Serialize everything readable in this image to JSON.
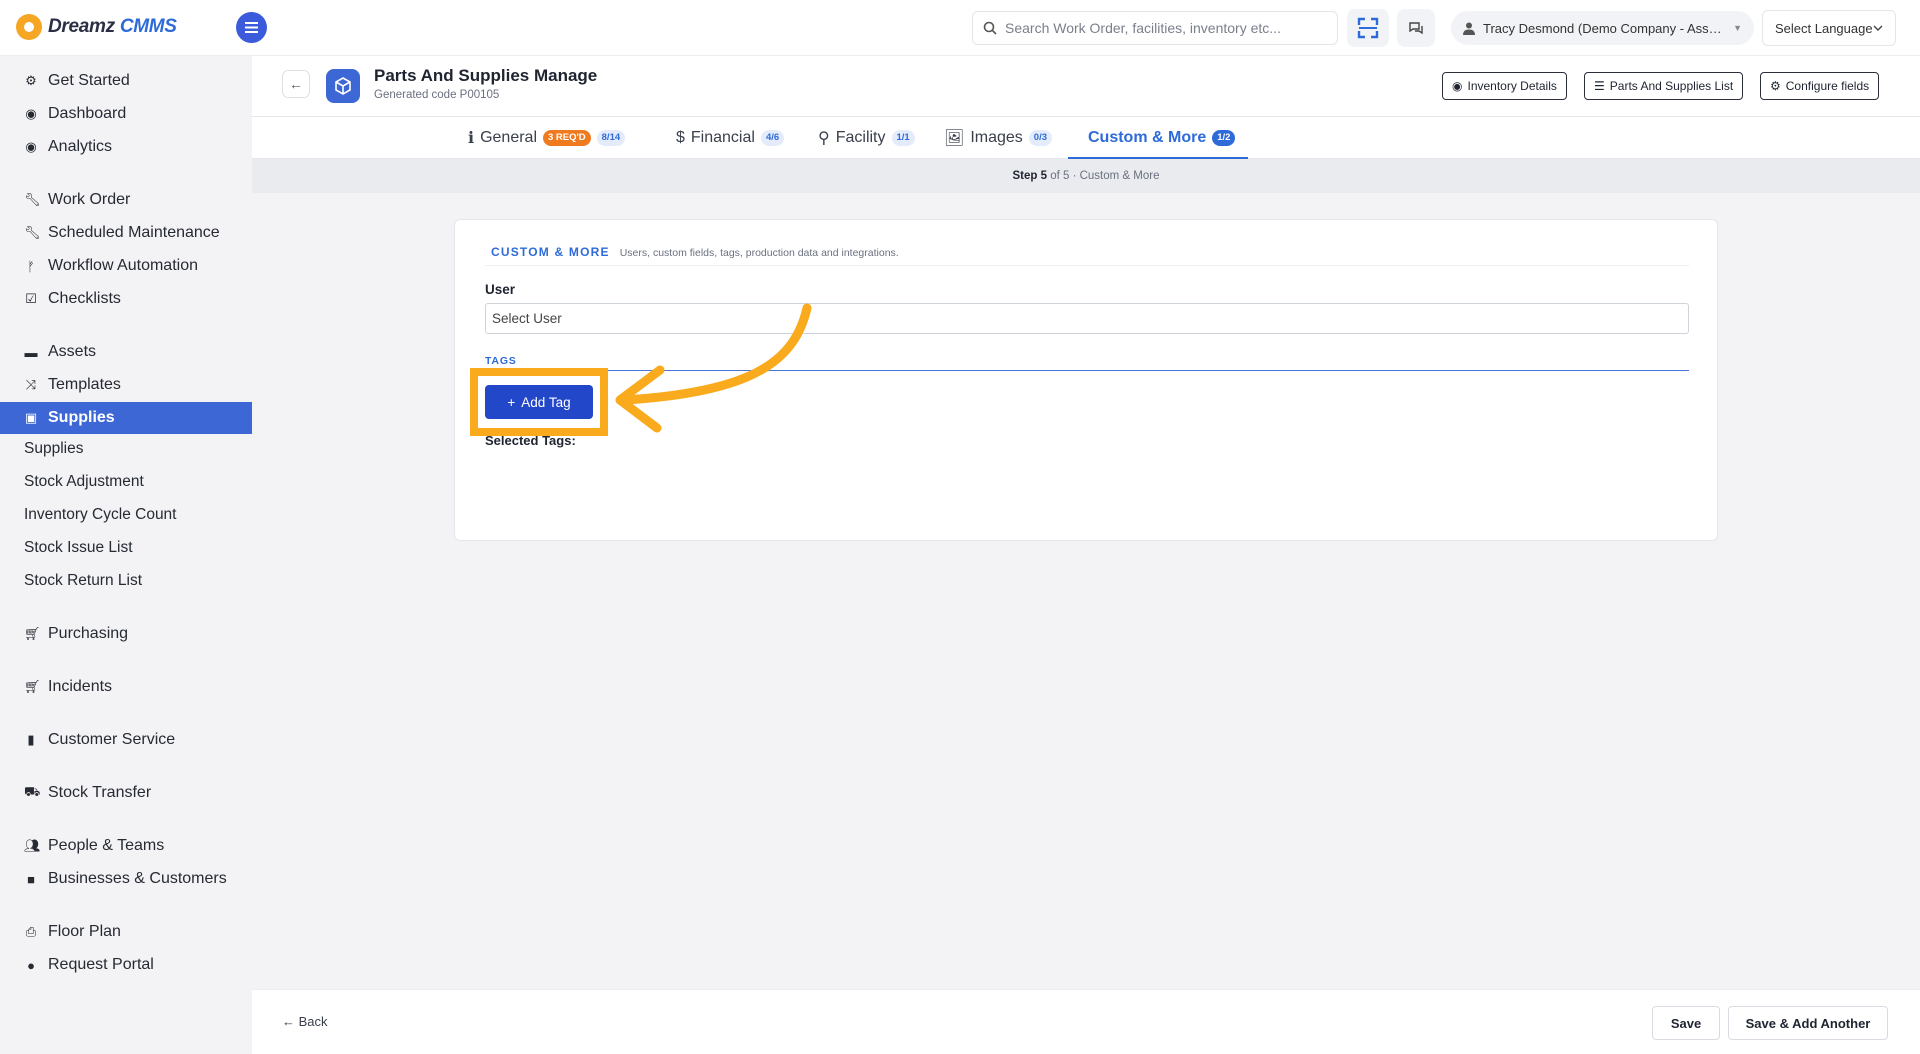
{
  "header": {
    "logo_main": "Dreamz",
    "logo_accent": "CMMS",
    "search_placeholder": "Search Work Order, facilities, inventory etc...",
    "user_label": "Tracy Desmond (Demo Company - Asse...",
    "language_label": "Select Language"
  },
  "sidebar": {
    "items": [
      {
        "label": "Get Started",
        "icon": "cogs-icon"
      },
      {
        "label": "Dashboard",
        "icon": "dashboard-icon"
      },
      {
        "label": "Analytics",
        "icon": "analytics-icon"
      },
      {
        "label": "Work Order",
        "icon": "wrench-icon"
      },
      {
        "label": "Scheduled Maintenance",
        "icon": "wrench-icon"
      },
      {
        "label": "Workflow Automation",
        "icon": "branch-icon"
      },
      {
        "label": "Checklists",
        "icon": "checkbox-icon"
      },
      {
        "label": "Assets",
        "icon": "archive-icon"
      },
      {
        "label": "Templates",
        "icon": "shuffle-icon"
      },
      {
        "label": "Supplies",
        "icon": "suitcase-icon"
      }
    ],
    "sub_items": [
      "Supplies",
      "Stock Adjustment",
      "Inventory Cycle Count",
      "Stock Issue List",
      "Stock Return List"
    ],
    "items_bottom": [
      {
        "label": "Purchasing",
        "icon": "cart-icon"
      },
      {
        "label": "Incidents",
        "icon": "cart-icon"
      },
      {
        "label": "Customer Service",
        "icon": "file-icon"
      },
      {
        "label": "Stock Transfer",
        "icon": "truck-icon"
      },
      {
        "label": "People & Teams",
        "icon": "users-icon"
      },
      {
        "label": "Businesses & Customers",
        "icon": "video-icon"
      },
      {
        "label": "Floor Plan",
        "icon": "printer-icon"
      },
      {
        "label": "Request Portal",
        "icon": "comment-icon"
      }
    ]
  },
  "page": {
    "title": "Parts And Supplies Manage",
    "subtitle": "Generated code P00105",
    "buttons": {
      "inventory_details": "Inventory Details",
      "parts_list": "Parts And Supplies List",
      "configure_fields": "Configure fields"
    }
  },
  "tabs": [
    {
      "label": "General",
      "icon": "info-icon",
      "req": "3 REQ'D",
      "count": "8/14"
    },
    {
      "label": "Financial",
      "icon": "dollar-icon",
      "count": "4/6"
    },
    {
      "label": "Facility",
      "icon": "map-pin-icon",
      "count": "1/1"
    },
    {
      "label": "Images",
      "icon": "image-icon",
      "count": "0/3"
    },
    {
      "label": "Custom & More",
      "count": "1/2",
      "active": true
    }
  ],
  "step": {
    "label": "Step 5",
    "rest": "of 5 · Custom & More"
  },
  "section": {
    "title": "CUSTOM & MORE",
    "description": "Users, custom fields, tags, production data and integrations.",
    "user_label": "User",
    "user_placeholder": "Select User",
    "tags_label": "TAGS",
    "add_tag_label": "Add Tag",
    "selected_tags_label": "Selected Tags:"
  },
  "footer": {
    "back_label": "Back",
    "save_label": "Save",
    "save_another_label": "Save & Add Another"
  },
  "colors": {
    "accent": "#2f6bd8",
    "sidebar_active": "#3e67d6",
    "highlight": "#f9ab1d",
    "required_badge": "#f07a1f"
  }
}
